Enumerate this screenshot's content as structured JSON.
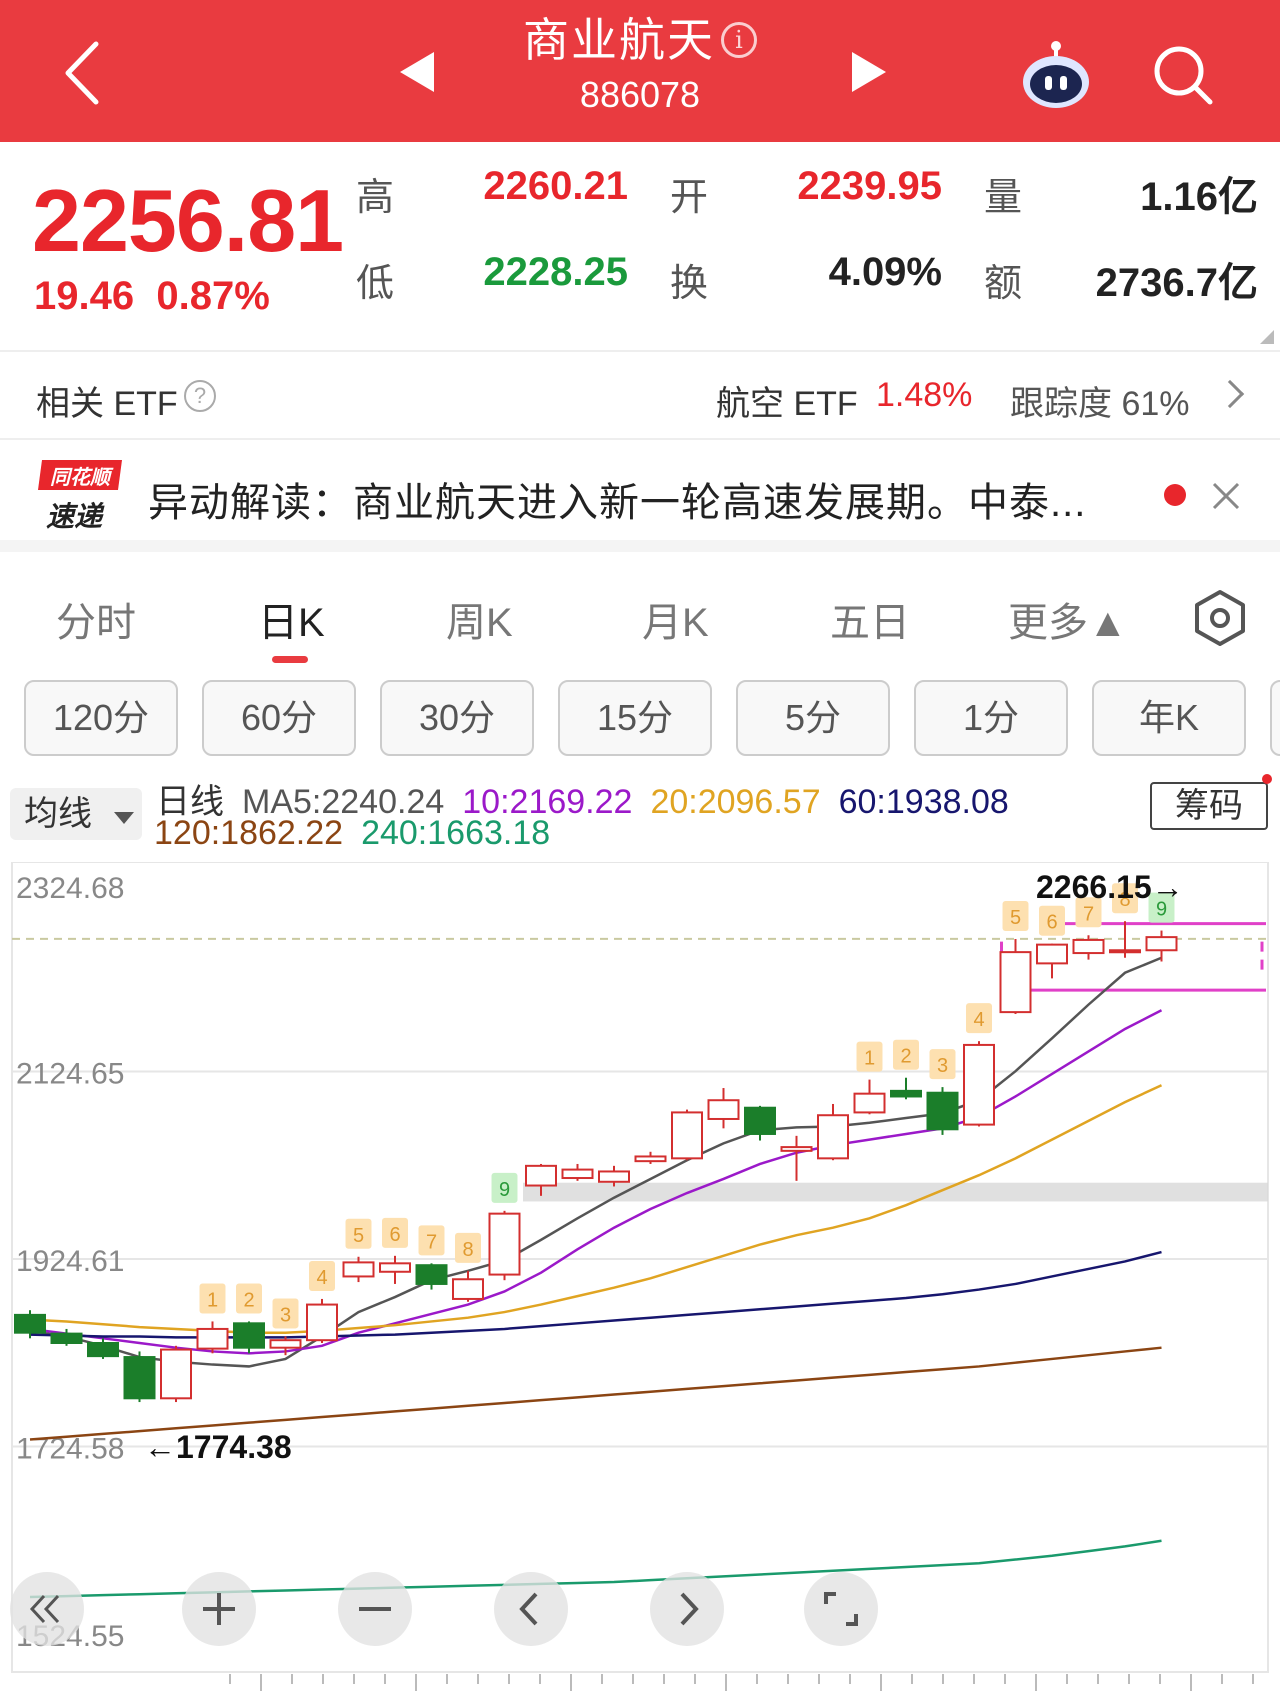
{
  "header": {
    "title": "商业航天",
    "info_glyph": "i",
    "code": "886078"
  },
  "quote": {
    "price": "2256.81",
    "change": "19.46",
    "change_pct": "0.87%",
    "high_label": "高",
    "high": "2260.21",
    "open_label": "开",
    "open": "2239.95",
    "volume_label": "量",
    "volume": "1.16亿",
    "low_label": "低",
    "low": "2228.25",
    "turnover_label": "换",
    "turnover": "4.09%",
    "amount_label": "额",
    "amount": "2736.7亿"
  },
  "etf": {
    "label": "相关 ETF",
    "help_glyph": "?",
    "name": "航空 ETF",
    "pct": "1.48%",
    "tracking": "跟踪度  61%"
  },
  "news": {
    "logo_top": "同花顺",
    "logo_bottom": "速递",
    "text": "异动解读：商业航天进入新一轮高速发展期。中泰..."
  },
  "tabs": [
    "分时",
    "日K",
    "周K",
    "月K",
    "五日",
    "更多▲"
  ],
  "active_tab": "日K",
  "periods": [
    "120分",
    "60分",
    "30分",
    "15分",
    "5分",
    "1分",
    "年K"
  ],
  "ma_legend": {
    "select_label": "均线",
    "prefix": "日线",
    "ma5": "MA5:2240.24",
    "ma10": "10:2169.22",
    "ma20": "20:2096.57",
    "ma60": "60:1938.08",
    "ma120": "120:1862.22",
    "ma240": "240:1663.18",
    "chip_button": "筹码"
  },
  "colors": {
    "header_red": "#e93b40",
    "up": "#d32f2f",
    "down": "#1b7e2a",
    "ma5": "#555555",
    "ma10": "#9b19c9",
    "ma20": "#e0a422",
    "ma60": "#17166e",
    "ma120": "#8b4513",
    "ma240": "#1a9a6c",
    "band": "#e040c8"
  },
  "chart_data": {
    "type": "candlestick",
    "y_ticks": [
      "2324.68",
      "2124.65",
      "1924.61",
      "1724.58",
      "1524.55"
    ],
    "ylim": [
      1524.55,
      2324.68
    ],
    "high_mark": "2266.15→",
    "low_mark": "←1774.38",
    "candles": [
      {
        "o": 1865,
        "h": 1870,
        "l": 1840,
        "c": 1846
      },
      {
        "o": 1845,
        "h": 1850,
        "l": 1832,
        "c": 1835
      },
      {
        "o": 1835,
        "h": 1840,
        "l": 1818,
        "c": 1821
      },
      {
        "o": 1820,
        "h": 1826,
        "l": 1772,
        "c": 1776
      },
      {
        "o": 1776,
        "h": 1832,
        "l": 1772,
        "c": 1828
      },
      {
        "o": 1829,
        "h": 1858,
        "l": 1824,
        "c": 1850,
        "tag": "1"
      },
      {
        "o": 1856,
        "h": 1858,
        "l": 1824,
        "c": 1830,
        "tag": "2"
      },
      {
        "o": 1830,
        "h": 1842,
        "l": 1822,
        "c": 1838,
        "tag": "3"
      },
      {
        "o": 1838,
        "h": 1882,
        "l": 1835,
        "c": 1876,
        "tag": "4"
      },
      {
        "o": 1906,
        "h": 1927,
        "l": 1900,
        "c": 1921,
        "tag": "5"
      },
      {
        "o": 1911,
        "h": 1928,
        "l": 1898,
        "c": 1920,
        "tag": "6"
      },
      {
        "o": 1918,
        "h": 1920,
        "l": 1892,
        "c": 1898,
        "tag": "7"
      },
      {
        "o": 1882,
        "h": 1912,
        "l": 1879,
        "c": 1903,
        "tag": "8"
      },
      {
        "o": 1908,
        "h": 1976,
        "l": 1902,
        "c": 1973,
        "tag": "9"
      },
      {
        "o": 2003,
        "h": 2026,
        "l": 1992,
        "c": 2024
      },
      {
        "o": 2011,
        "h": 2026,
        "l": 2008,
        "c": 2020
      },
      {
        "o": 2007,
        "h": 2024,
        "l": 2002,
        "c": 2018
      },
      {
        "o": 2029,
        "h": 2039,
        "l": 2026,
        "c": 2034
      },
      {
        "o": 2032,
        "h": 2084,
        "l": 2030,
        "c": 2081
      },
      {
        "o": 2074,
        "h": 2107,
        "l": 2064,
        "c": 2094
      },
      {
        "o": 2086,
        "h": 2088,
        "l": 2051,
        "c": 2058
      },
      {
        "o": 2040,
        "h": 2056,
        "l": 2008,
        "c": 2044
      },
      {
        "o": 2032,
        "h": 2090,
        "l": 2030,
        "c": 2078
      },
      {
        "o": 2081,
        "h": 2116,
        "l": 2079,
        "c": 2101,
        "tag": "1"
      },
      {
        "o": 2104,
        "h": 2118,
        "l": 2095,
        "c": 2098,
        "tag": "2"
      },
      {
        "o": 2102,
        "h": 2108,
        "l": 2057,
        "c": 2063,
        "tag": "3"
      },
      {
        "o": 2068,
        "h": 2157,
        "l": 2066,
        "c": 2153,
        "tag": "4"
      },
      {
        "o": 2188,
        "h": 2266,
        "l": 2186,
        "c": 2252,
        "tag": "5"
      },
      {
        "o": 2240,
        "h": 2261,
        "l": 2224,
        "c": 2260,
        "tag": "6"
      },
      {
        "o": 2251,
        "h": 2270,
        "l": 2244,
        "c": 2265,
        "tag": "7"
      },
      {
        "o": 2252,
        "h": 2285,
        "l": 2246,
        "c": 2254,
        "tag": "8"
      },
      {
        "o": 2254,
        "h": 2275,
        "l": 2242,
        "c": 2268,
        "tag": "9"
      }
    ],
    "ma_series": [
      {
        "name": "MA5",
        "values": [
          1848,
          1842,
          1832,
          1820,
          1815,
          1812,
          1810,
          1818,
          1842,
          1868,
          1884,
          1902,
          1912,
          1923,
          1945,
          1968,
          1990,
          2010,
          2030,
          2048,
          2062,
          2065,
          2066,
          2070,
          2075,
          2080,
          2094,
          2125,
          2160,
          2196,
          2230,
          2246
        ]
      },
      {
        "name": "MA10",
        "values": [
          1850,
          1845,
          1840,
          1835,
          1830,
          1826,
          1824,
          1826,
          1832,
          1846,
          1856,
          1866,
          1876,
          1890,
          1910,
          1935,
          1958,
          1978,
          1995,
          2010,
          2026,
          2038,
          2046,
          2052,
          2058,
          2064,
          2076,
          2098,
          2122,
          2146,
          2170,
          2190
        ]
      },
      {
        "name": "MA20",
        "values": [
          1860,
          1858,
          1855,
          1852,
          1850,
          1848,
          1846,
          1846,
          1848,
          1851,
          1854,
          1858,
          1862,
          1868,
          1876,
          1885,
          1894,
          1904,
          1916,
          1928,
          1940,
          1950,
          1958,
          1968,
          1982,
          1998,
          2014,
          2032,
          2052,
          2072,
          2092,
          2110
        ]
      },
      {
        "name": "MA60",
        "values": [
          1844,
          1843,
          1842,
          1842,
          1841,
          1841,
          1841,
          1841,
          1842,
          1843,
          1844,
          1846,
          1848,
          1850,
          1853,
          1856,
          1859,
          1862,
          1865,
          1868,
          1871,
          1874,
          1877,
          1880,
          1883,
          1887,
          1892,
          1898,
          1906,
          1914,
          1922,
          1932
        ]
      },
      {
        "name": "MA120",
        "values": [
          1732,
          1735,
          1738,
          1741,
          1744,
          1747,
          1750,
          1753,
          1756,
          1759,
          1762,
          1765,
          1768,
          1771,
          1774,
          1777,
          1780,
          1783,
          1786,
          1789,
          1792,
          1795,
          1798,
          1801,
          1804,
          1807,
          1810,
          1814,
          1818,
          1822,
          1826,
          1830
        ]
      },
      {
        "name": "MA240",
        "values": [
          1564,
          1565,
          1566,
          1567,
          1568,
          1569,
          1570,
          1571,
          1572,
          1573,
          1574,
          1575,
          1576,
          1577,
          1578,
          1579,
          1580,
          1582,
          1584,
          1586,
          1588,
          1590,
          1592,
          1594,
          1596,
          1598,
          1600,
          1604,
          1608,
          1613,
          1618,
          1624
        ]
      }
    ],
    "reference_level": 2266.15,
    "support_band": [
      1986,
      2006
    ],
    "consolidation_box": [
      2220,
      2276
    ]
  }
}
